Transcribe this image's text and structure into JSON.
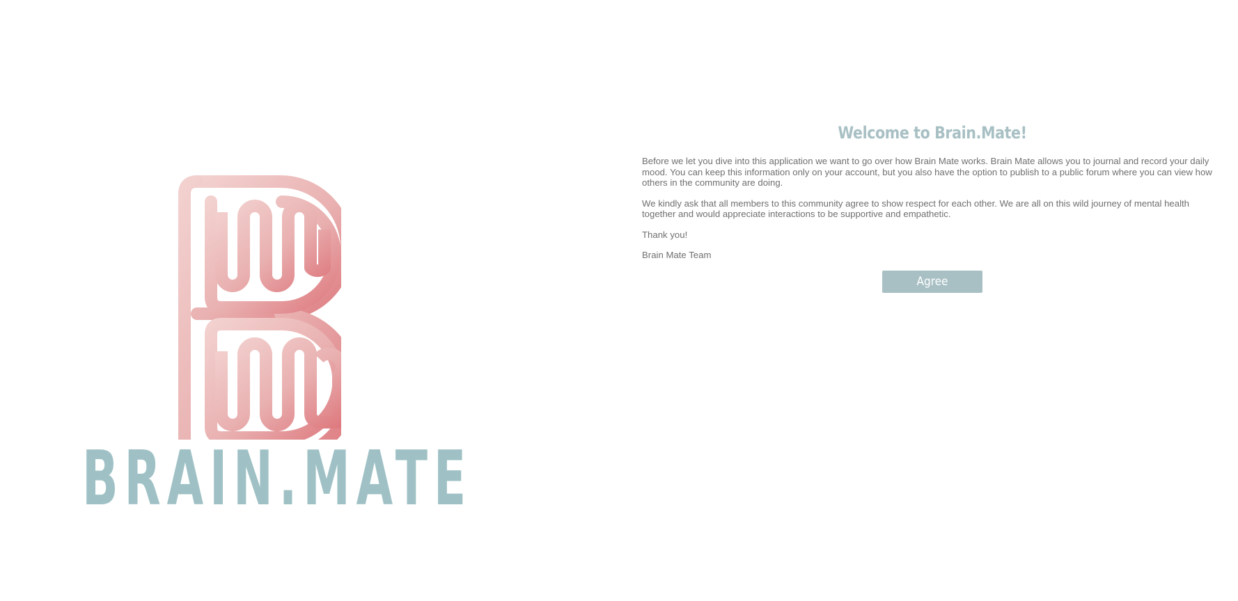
{
  "brand": {
    "wordmark": "BRAIN.MATE",
    "logo_icon": "brain-b-logo-icon"
  },
  "welcome": {
    "title": "Welcome to Brain.Mate!",
    "paragraphs": [
      "Before we let you dive into this application we want to go over how Brain Mate works. Brain Mate allows you to journal and record your daily mood. You can keep this information only on your account, but you also have the option to publish to a public forum where you can view how others in the community are doing.",
      "We kindly ask that all members to this community agree to show respect for each other. We are all on this wild journey of mental health together and would appreciate interactions to be supportive and empathetic.",
      "Thank you!",
      "Brain Mate Team"
    ],
    "agree_label": "Agree"
  },
  "colors": {
    "accent": "#a8c0c4",
    "wordmark": "#9fc1c5",
    "logo_light": "#f1cdcc",
    "logo_dark": "#de7c80",
    "text": "#6f6f6f",
    "background": "#ffffff"
  }
}
